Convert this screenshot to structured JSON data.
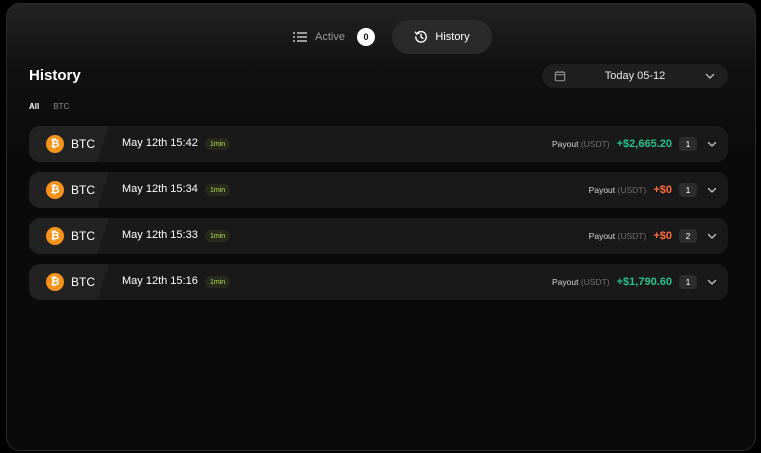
{
  "tabs": {
    "active_label": "Active",
    "active_count": "0",
    "history_label": "History"
  },
  "header": {
    "title": "History",
    "date_label": "Today 05-12"
  },
  "filters": [
    {
      "label": "All",
      "active": true
    },
    {
      "label": "BTC",
      "active": false
    }
  ],
  "payout_label": "Payout",
  "payout_unit": "(USDT)",
  "rows": [
    {
      "coin": "BTC",
      "time": "May 12th 15:42",
      "duration": "1min",
      "amount": "+$2,665.20",
      "amount_color": "#22c48a",
      "count": "1"
    },
    {
      "coin": "BTC",
      "time": "May 12th 15:34",
      "duration": "1min",
      "amount": "+$0",
      "amount_color": "#ff6a3d",
      "count": "1"
    },
    {
      "coin": "BTC",
      "time": "May 12th 15:33",
      "duration": "1min",
      "amount": "+$0",
      "amount_color": "#ff6a3d",
      "count": "2"
    },
    {
      "coin": "BTC",
      "time": "May 12th 15:16",
      "duration": "1min",
      "amount": "+$1,790.60",
      "amount_color": "#22c48a",
      "count": "1"
    }
  ],
  "icons": {
    "active": "list-icon",
    "history": "history-clock-icon",
    "calendar": "calendar-icon",
    "dropdown": "chevron-down-icon",
    "coin": "bitcoin-icon",
    "expand": "chevron-down-icon"
  }
}
